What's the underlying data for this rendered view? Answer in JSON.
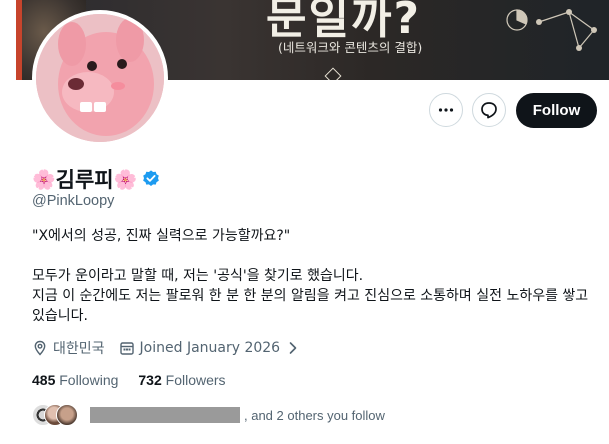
{
  "banner": {
    "headline": "문일까?",
    "subtitle": "(네트워크와 콘텐츠의 결합)"
  },
  "profile": {
    "name": "김루피",
    "name_emoji": "🌸",
    "handle": "@PinkLoopy",
    "bio": "\"X에서의 성공, 진짜 실력으로 가능할까요?\"\n\n모두가 운이라고 말할 때, 저는 '공식'을 찾기로 했습니다.\n지금 이 순간에도 저는 팔로워 한 분 한 분의 알림을 켜고 진심으로 소통하며 실전 노하우를 쌓고 있습니다.",
    "location": "대한민국",
    "joined": "Joined January 2026"
  },
  "actions": {
    "follow_label": "Follow"
  },
  "stats": {
    "following_count": "485",
    "following_label": "Following",
    "followers_count": "732",
    "followers_label": "Followers"
  },
  "followed_by": {
    "suffix": ", and 2 others you follow"
  },
  "colors": {
    "accent": "#0f1419",
    "verified": "#1d9bf0",
    "secondary_text": "#536471"
  },
  "icons": [
    "more-icon",
    "message-icon",
    "verified-icon",
    "location-icon",
    "calendar-icon",
    "chevron-right-icon"
  ]
}
